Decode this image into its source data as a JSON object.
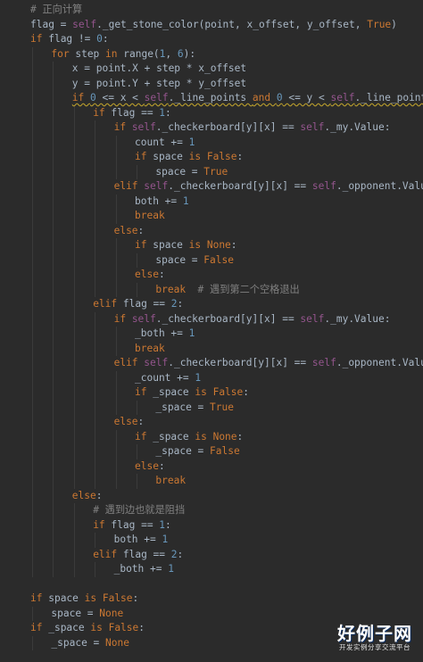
{
  "colors": {
    "background": "#2b2b2b",
    "keyword": "#cc7832",
    "self": "#94558d",
    "number": "#6897bb",
    "comment": "#808080",
    "text": "#a9b7c6"
  },
  "code_lines": [
    {
      "indent": 0,
      "tokens": [
        [
          "cmt",
          "# 正向计算"
        ]
      ]
    },
    {
      "indent": 0,
      "tokens": [
        [
          "ident",
          "flag = "
        ],
        [
          "self",
          "self"
        ],
        [
          "ident",
          "._get_stone_color(point, x_offset, y_offset, "
        ],
        [
          "kw",
          "True"
        ],
        [
          "ident",
          ")"
        ]
      ]
    },
    {
      "indent": 0,
      "tokens": [
        [
          "kw",
          "if "
        ],
        [
          "ident",
          "flag != "
        ],
        [
          "num",
          "0"
        ],
        [
          "ident",
          ":"
        ]
      ]
    },
    {
      "indent": 1,
      "tokens": [
        [
          "kw",
          "for "
        ],
        [
          "ident",
          "step "
        ],
        [
          "kw",
          "in "
        ],
        [
          "ident",
          "range("
        ],
        [
          "num",
          "1"
        ],
        [
          "ident",
          ", "
        ],
        [
          "num",
          "6"
        ],
        [
          "ident",
          "):"
        ]
      ]
    },
    {
      "indent": 2,
      "tokens": [
        [
          "ident",
          "x = point.X + step * x_offset"
        ]
      ]
    },
    {
      "indent": 2,
      "tokens": [
        [
          "ident",
          "y = point.Y + step * y_offset"
        ]
      ]
    },
    {
      "indent": 2,
      "warn": true,
      "tokens": [
        [
          "kw",
          "if "
        ],
        [
          "num",
          "0"
        ],
        [
          "ident",
          " <= x < "
        ],
        [
          "self",
          "self"
        ],
        [
          "ident",
          "._line_points "
        ],
        [
          "kw",
          "and "
        ],
        [
          "num",
          "0"
        ],
        [
          "ident",
          " <= y < "
        ],
        [
          "self",
          "self"
        ],
        [
          "ident",
          "._line_points:"
        ]
      ]
    },
    {
      "indent": 3,
      "tokens": [
        [
          "kw",
          "if "
        ],
        [
          "ident",
          "flag == "
        ],
        [
          "num",
          "1"
        ],
        [
          "ident",
          ":"
        ]
      ]
    },
    {
      "indent": 4,
      "tokens": [
        [
          "kw",
          "if "
        ],
        [
          "self",
          "self"
        ],
        [
          "ident",
          "._checkerboard[y][x] == "
        ],
        [
          "self",
          "self"
        ],
        [
          "ident",
          "._my.Value:"
        ]
      ]
    },
    {
      "indent": 5,
      "tokens": [
        [
          "ident",
          "count += "
        ],
        [
          "num",
          "1"
        ]
      ]
    },
    {
      "indent": 5,
      "tokens": [
        [
          "kw",
          "if "
        ],
        [
          "ident",
          "space "
        ],
        [
          "kw",
          "is False"
        ],
        [
          "ident",
          ":"
        ]
      ]
    },
    {
      "indent": 6,
      "tokens": [
        [
          "ident",
          "space = "
        ],
        [
          "kw",
          "True"
        ]
      ]
    },
    {
      "indent": 4,
      "tokens": [
        [
          "kw",
          "elif "
        ],
        [
          "self",
          "self"
        ],
        [
          "ident",
          "._checkerboard[y][x] == "
        ],
        [
          "self",
          "self"
        ],
        [
          "ident",
          "._opponent.Value:"
        ]
      ]
    },
    {
      "indent": 5,
      "tokens": [
        [
          "ident",
          "both += "
        ],
        [
          "num",
          "1"
        ]
      ]
    },
    {
      "indent": 5,
      "tokens": [
        [
          "kw",
          "break"
        ]
      ]
    },
    {
      "indent": 4,
      "tokens": [
        [
          "kw",
          "else"
        ],
        [
          "ident",
          ":"
        ]
      ]
    },
    {
      "indent": 5,
      "tokens": [
        [
          "kw",
          "if "
        ],
        [
          "ident",
          "space "
        ],
        [
          "kw",
          "is None"
        ],
        [
          "ident",
          ":"
        ]
      ]
    },
    {
      "indent": 6,
      "tokens": [
        [
          "ident",
          "space = "
        ],
        [
          "kw",
          "False"
        ]
      ]
    },
    {
      "indent": 5,
      "tokens": [
        [
          "kw",
          "else"
        ],
        [
          "ident",
          ":"
        ]
      ]
    },
    {
      "indent": 6,
      "tokens": [
        [
          "kw",
          "break  "
        ],
        [
          "cmt",
          "# 遇到第二个空格退出"
        ]
      ]
    },
    {
      "indent": 3,
      "tokens": [
        [
          "kw",
          "elif "
        ],
        [
          "ident",
          "flag == "
        ],
        [
          "num",
          "2"
        ],
        [
          "ident",
          ":"
        ]
      ]
    },
    {
      "indent": 4,
      "tokens": [
        [
          "kw",
          "if "
        ],
        [
          "self",
          "self"
        ],
        [
          "ident",
          "._checkerboard[y][x] == "
        ],
        [
          "self",
          "self"
        ],
        [
          "ident",
          "._my.Value:"
        ]
      ]
    },
    {
      "indent": 5,
      "tokens": [
        [
          "ident",
          "_both += "
        ],
        [
          "num",
          "1"
        ]
      ]
    },
    {
      "indent": 5,
      "tokens": [
        [
          "kw",
          "break"
        ]
      ]
    },
    {
      "indent": 4,
      "tokens": [
        [
          "kw",
          "elif "
        ],
        [
          "self",
          "self"
        ],
        [
          "ident",
          "._checkerboard[y][x] == "
        ],
        [
          "self",
          "self"
        ],
        [
          "ident",
          "._opponent.Value:"
        ]
      ]
    },
    {
      "indent": 5,
      "tokens": [
        [
          "ident",
          "_count += "
        ],
        [
          "num",
          "1"
        ]
      ]
    },
    {
      "indent": 5,
      "tokens": [
        [
          "kw",
          "if "
        ],
        [
          "ident",
          "_space "
        ],
        [
          "kw",
          "is False"
        ],
        [
          "ident",
          ":"
        ]
      ]
    },
    {
      "indent": 6,
      "tokens": [
        [
          "ident",
          "_space = "
        ],
        [
          "kw",
          "True"
        ]
      ]
    },
    {
      "indent": 4,
      "tokens": [
        [
          "kw",
          "else"
        ],
        [
          "ident",
          ":"
        ]
      ]
    },
    {
      "indent": 5,
      "tokens": [
        [
          "kw",
          "if "
        ],
        [
          "ident",
          "_space "
        ],
        [
          "kw",
          "is None"
        ],
        [
          "ident",
          ":"
        ]
      ]
    },
    {
      "indent": 6,
      "tokens": [
        [
          "ident",
          "_space = "
        ],
        [
          "kw",
          "False"
        ]
      ]
    },
    {
      "indent": 5,
      "tokens": [
        [
          "kw",
          "else"
        ],
        [
          "ident",
          ":"
        ]
      ]
    },
    {
      "indent": 6,
      "tokens": [
        [
          "kw",
          "break"
        ]
      ]
    },
    {
      "indent": 2,
      "tokens": [
        [
          "kw",
          "else"
        ],
        [
          "ident",
          ":"
        ]
      ]
    },
    {
      "indent": 3,
      "tokens": [
        [
          "cmt",
          "# 遇到边也就是阻挡"
        ]
      ]
    },
    {
      "indent": 3,
      "tokens": [
        [
          "kw",
          "if "
        ],
        [
          "ident",
          "flag == "
        ],
        [
          "num",
          "1"
        ],
        [
          "ident",
          ":"
        ]
      ]
    },
    {
      "indent": 4,
      "tokens": [
        [
          "ident",
          "both += "
        ],
        [
          "num",
          "1"
        ]
      ]
    },
    {
      "indent": 3,
      "tokens": [
        [
          "kw",
          "elif "
        ],
        [
          "ident",
          "flag == "
        ],
        [
          "num",
          "2"
        ],
        [
          "ident",
          ":"
        ]
      ]
    },
    {
      "indent": 4,
      "tokens": [
        [
          "ident",
          "_both += "
        ],
        [
          "num",
          "1"
        ]
      ]
    },
    {
      "indent": 0,
      "tokens": []
    },
    {
      "indent": 0,
      "tokens": [
        [
          "kw",
          "if "
        ],
        [
          "ident",
          "space "
        ],
        [
          "kw",
          "is False"
        ],
        [
          "ident",
          ":"
        ]
      ]
    },
    {
      "indent": 1,
      "tokens": [
        [
          "ident",
          "space = "
        ],
        [
          "kw",
          "None"
        ]
      ]
    },
    {
      "indent": 0,
      "tokens": [
        [
          "kw",
          "if "
        ],
        [
          "ident",
          "_space "
        ],
        [
          "kw",
          "is False"
        ],
        [
          "ident",
          ":"
        ]
      ]
    },
    {
      "indent": 1,
      "tokens": [
        [
          "ident",
          "_space = "
        ],
        [
          "kw",
          "None"
        ]
      ]
    }
  ],
  "watermark": {
    "main": "好例子网",
    "sub": "开发实例分享交流平台"
  }
}
